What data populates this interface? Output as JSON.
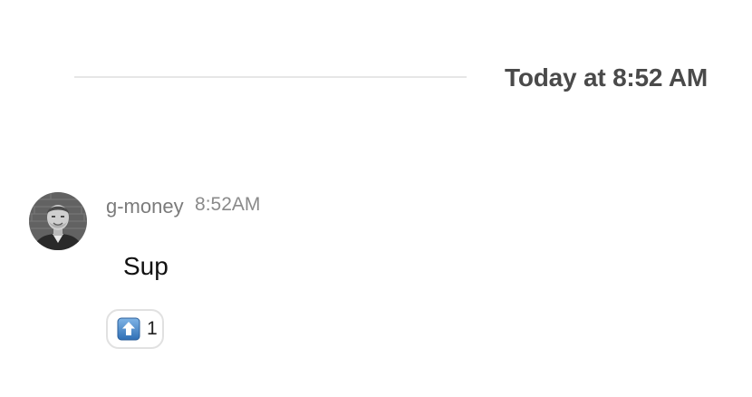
{
  "day_divider": {
    "label": "Today at 8:52 AM"
  },
  "message": {
    "sender": "g-money",
    "time": "8:52AM",
    "text": "Sup",
    "avatar_icon": "user-avatar-photo",
    "reactions": [
      {
        "emoji": "arrow-up-icon",
        "count": "1"
      }
    ]
  },
  "colors": {
    "divider_line": "#e6e6e6",
    "divider_label": "#4a4a4a",
    "sender_name": "#7b7b7b",
    "timestamp": "#8a8a8a",
    "reaction_border": "#e1e1e1",
    "reaction_emoji_blue": "#3f83c8"
  }
}
